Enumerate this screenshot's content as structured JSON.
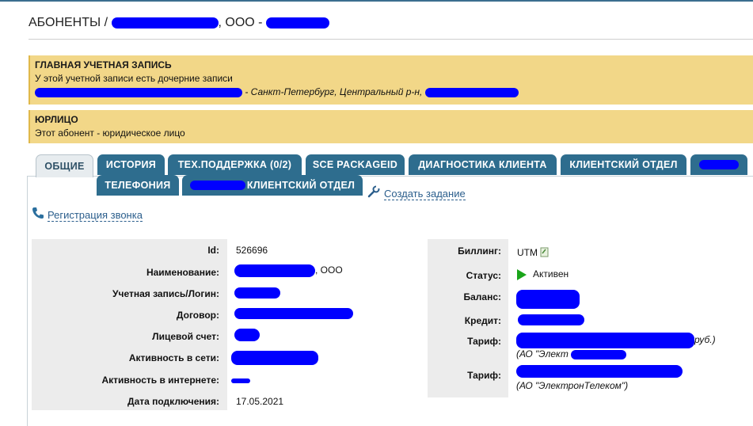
{
  "header": {
    "title_prefix": "АБОНЕНТЫ /",
    "title_middle": ", ООО -"
  },
  "notices": [
    {
      "heading": "ГЛАВНАЯ УЧЕТНАЯ ЗАПИСЬ",
      "line1": "У этой учетной записи есть дочерние записи",
      "line2_suffix": "- Санкт-Петербург, Центральный р-н,"
    },
    {
      "heading": "ЮРЛИЦО",
      "line1": "Этот абонент - юридическое лицо"
    }
  ],
  "tabs": {
    "row1": [
      "ОБЩИЕ",
      "ИСТОРИЯ",
      "ТЕХ.ПОДДЕРЖКА (0/2)",
      "SCE PACKAGEID",
      "ДИАГНОСТИКА КЛИЕНТА",
      "КЛИЕНТСКИЙ ОТДЕЛ"
    ],
    "row2": [
      "ТЕЛЕФОНИЯ",
      "КЛИЕНТСКИЙ ОТДЕЛ"
    ],
    "active": "ОБЩИЕ"
  },
  "actions": {
    "create_task": "Создать задание",
    "register_call": "Регистрация звонка"
  },
  "left_fields": {
    "id_label": "Id:",
    "id_value": "526696",
    "name_label": "Наименование:",
    "name_value_suffix": ", ООО",
    "login_label": "Учетная запись/Логин:",
    "contract_label": "Договор:",
    "account_label": "Лицевой счет:",
    "net_activity_label": "Активность в сети:",
    "inet_activity_label": "Активность в интернете:",
    "connect_date_label": "Дата подключения:",
    "connect_date_value": "17.05.2021"
  },
  "right_fields": {
    "billing_label": "Биллинг:",
    "billing_value": "UTM",
    "status_label": "Статус:",
    "status_value": "Активен",
    "balance_label": "Баланс:",
    "credit_label": "Кредит:",
    "tariff1_label": "Тариф:",
    "tariff1_suffix": "руб.)",
    "tariff1_provider": "(АО \"Элект",
    "tariff2_label": "Тариф:",
    "tariff2_provider": "(АО \"ЭлектронТелеком\")"
  },
  "colors": {
    "tab_bg": "#2e6d8e",
    "notice_bg": "#f2d788",
    "redaction": "#0000ff",
    "status_active": "#1aa51a",
    "link": "#2b5e8c"
  }
}
